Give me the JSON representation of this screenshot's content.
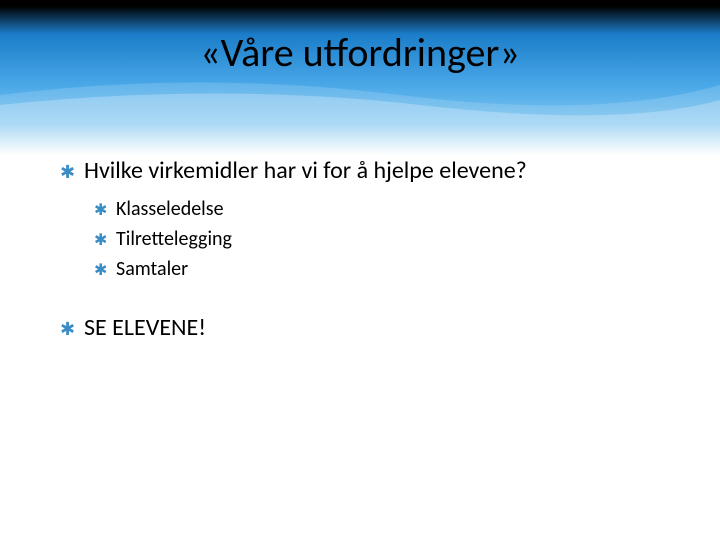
{
  "title": "«Våre utfordringer»",
  "bullets": [
    {
      "text": "Hvilke virkemidler har vi for å hjelpe elevene?",
      "sub": [
        "Klasseledelse",
        "Tilrettelegging",
        "Samtaler"
      ]
    },
    {
      "text": "SE ELEVENE!",
      "sub": []
    }
  ],
  "colors": {
    "accent": "#3a8cc4",
    "gradient_top": "#1b7dc9",
    "gradient_mid": "#4aa8e8"
  }
}
